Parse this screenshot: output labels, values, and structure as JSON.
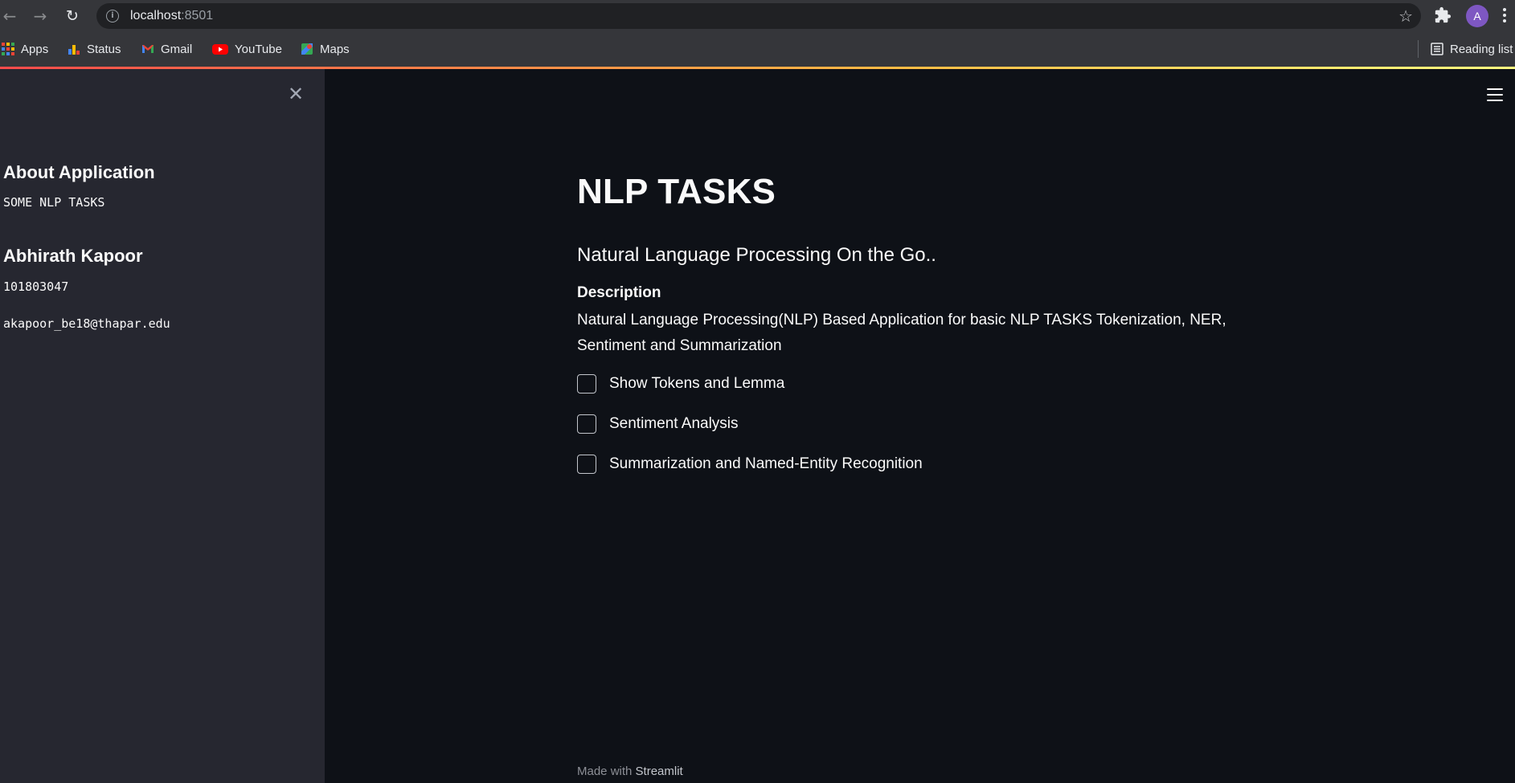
{
  "browser": {
    "url_host": "localhost",
    "url_port": ":8501",
    "profile_initial": "A",
    "bookmarks": [
      {
        "label": "Apps",
        "icon": "apps-grid-icon"
      },
      {
        "label": "Status",
        "icon": "status-bar-icon"
      },
      {
        "label": "Gmail",
        "icon": "gmail-icon"
      },
      {
        "label": "YouTube",
        "icon": "youtube-icon"
      },
      {
        "label": "Maps",
        "icon": "maps-icon"
      }
    ],
    "reading_list": "Reading list"
  },
  "sidebar": {
    "about_heading": "About Application",
    "about_text": "SOME NLP TASKS",
    "author_name": "Abhirath Kapoor",
    "author_id": "101803047",
    "author_email": "akapoor_be18@thapar.edu"
  },
  "main": {
    "title": "NLP TASKS",
    "subtitle": "Natural Language Processing On the Go..",
    "description_label": "Description",
    "description_text": "Natural Language Processing(NLP) Based Application for basic NLP TASKS Tokenization, NER, Sentiment and Summarization",
    "checkboxes": [
      {
        "label": "Show Tokens and Lemma",
        "checked": false
      },
      {
        "label": "Sentiment Analysis",
        "checked": false
      },
      {
        "label": "Summarization and Named-Entity Recognition",
        "checked": false
      }
    ],
    "footer_prefix": "Made with",
    "footer_brand": "Streamlit"
  },
  "colors": {
    "background": "#0e1117",
    "sidebar": "#262730",
    "text": "#fafafa",
    "accent_start": "#ff4b4b",
    "accent_end": "#fffd80"
  }
}
